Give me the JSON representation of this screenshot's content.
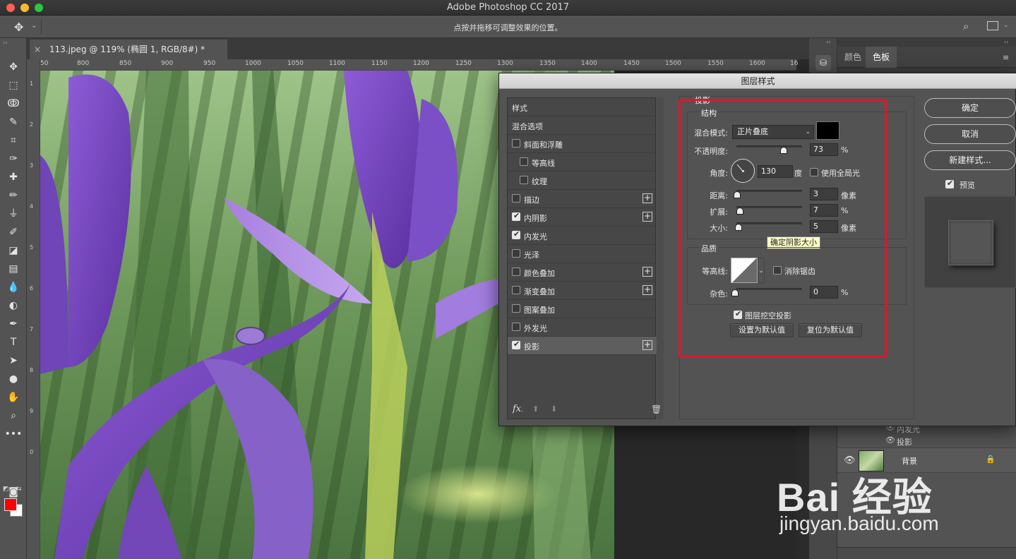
{
  "app": {
    "title": "Adobe Photoshop CC 2017"
  },
  "options_bar": {
    "hint": "点按并拖移可调整效果的位置。"
  },
  "document": {
    "tab_title": "113.jpeg @ 119% (椭圆 1, RGB/8#) *",
    "tab_close": "×",
    "ruler_h": [
      "50",
      "800",
      "850",
      "900",
      "950",
      "1000",
      "1050",
      "1100",
      "1150",
      "1200",
      "1250",
      "1300",
      "1350",
      "1400",
      "1450",
      "1500",
      "1550",
      "1600",
      "16"
    ],
    "ruler_v": [
      "1",
      "2",
      "3",
      "4",
      "5",
      "6",
      "7",
      "8",
      "9",
      "0"
    ]
  },
  "toolbar": {
    "tools": [
      "move-tool",
      "marquee-tool",
      "lasso-tool",
      "quick-select-tool",
      "crop-tool",
      "eyedropper-tool",
      "healing-tool",
      "brush-tool",
      "stamp-tool",
      "history-brush-tool",
      "eraser-tool",
      "gradient-tool",
      "blur-tool",
      "dodge-tool",
      "pen-tool",
      "type-tool",
      "path-select-tool",
      "shape-tool",
      "hand-tool",
      "zoom-tool",
      "more-tools"
    ],
    "foreground_color": "#ff0000",
    "background_color": "#ffffff"
  },
  "right_panel": {
    "tabs": [
      "颜色",
      "色板"
    ],
    "active_tab": "色板",
    "layer_effect_rows": [
      "内发光",
      "投影"
    ],
    "background_layer": "背景"
  },
  "watermark": {
    "brand": "Bai 经验",
    "url": "jingyan.baidu.com"
  },
  "dialog": {
    "title": "图层样式",
    "styles": [
      {
        "label": "样式",
        "checkbox": false,
        "plus": false,
        "indent": 0
      },
      {
        "label": "混合选项",
        "checkbox": false,
        "plus": false,
        "indent": 0
      },
      {
        "label": "斜面和浮雕",
        "checkbox": true,
        "checked": false,
        "plus": false,
        "indent": 0
      },
      {
        "label": "等高线",
        "checkbox": true,
        "checked": false,
        "plus": false,
        "indent": 1
      },
      {
        "label": "纹理",
        "checkbox": true,
        "checked": false,
        "plus": false,
        "indent": 1
      },
      {
        "label": "描边",
        "checkbox": true,
        "checked": false,
        "plus": true,
        "indent": 0
      },
      {
        "label": "内阴影",
        "checkbox": true,
        "checked": true,
        "plus": true,
        "indent": 0
      },
      {
        "label": "内发光",
        "checkbox": true,
        "checked": true,
        "plus": false,
        "indent": 0
      },
      {
        "label": "光泽",
        "checkbox": true,
        "checked": false,
        "plus": false,
        "indent": 0
      },
      {
        "label": "颜色叠加",
        "checkbox": true,
        "checked": false,
        "plus": true,
        "indent": 0
      },
      {
        "label": "渐变叠加",
        "checkbox": true,
        "checked": false,
        "plus": true,
        "indent": 0
      },
      {
        "label": "图案叠加",
        "checkbox": true,
        "checked": false,
        "plus": false,
        "indent": 0
      },
      {
        "label": "外发光",
        "checkbox": true,
        "checked": false,
        "plus": false,
        "indent": 0
      },
      {
        "label": "投影",
        "checkbox": true,
        "checked": true,
        "plus": true,
        "indent": 0,
        "selected": true
      }
    ],
    "footer": {
      "fx": "fx",
      "fx_dot": "."
    },
    "drop_shadow": {
      "title": "投影",
      "structure": {
        "title": "结构",
        "blend_mode_label": "混合模式:",
        "blend_mode_value": "正片叠底",
        "shadow_color": "#000000",
        "opacity_label": "不透明度:",
        "opacity_value": "73",
        "opacity_unit": "%",
        "opacity_level": 73,
        "angle_label": "角度:",
        "angle_value": "130",
        "angle_unit": "度",
        "global_light_label": "使用全局光",
        "global_light_checked": false,
        "distance_label": "距离:",
        "distance_value": "3",
        "distance_unit": "像素",
        "spread_label": "扩展:",
        "spread_value": "7",
        "spread_unit": "%",
        "size_label": "大小:",
        "size_value": "5",
        "size_unit": "像素",
        "tooltip": "确定阴影大小"
      },
      "quality": {
        "title": "品质",
        "contour_label": "等高线:",
        "antialias_label": "消除锯齿",
        "antialias_checked": false,
        "noise_label": "杂色:",
        "noise_value": "0",
        "noise_unit": "%"
      },
      "knockout_label": "图层挖空投影",
      "knockout_checked": true,
      "set_default_label": "设置为默认值",
      "reset_default_label": "复位为默认值"
    },
    "buttons": {
      "ok": "确定",
      "cancel": "取消",
      "new_style": "新建样式...",
      "preview_label": "预览",
      "preview_checked": true
    },
    "highlight_color": "#e8132a"
  }
}
